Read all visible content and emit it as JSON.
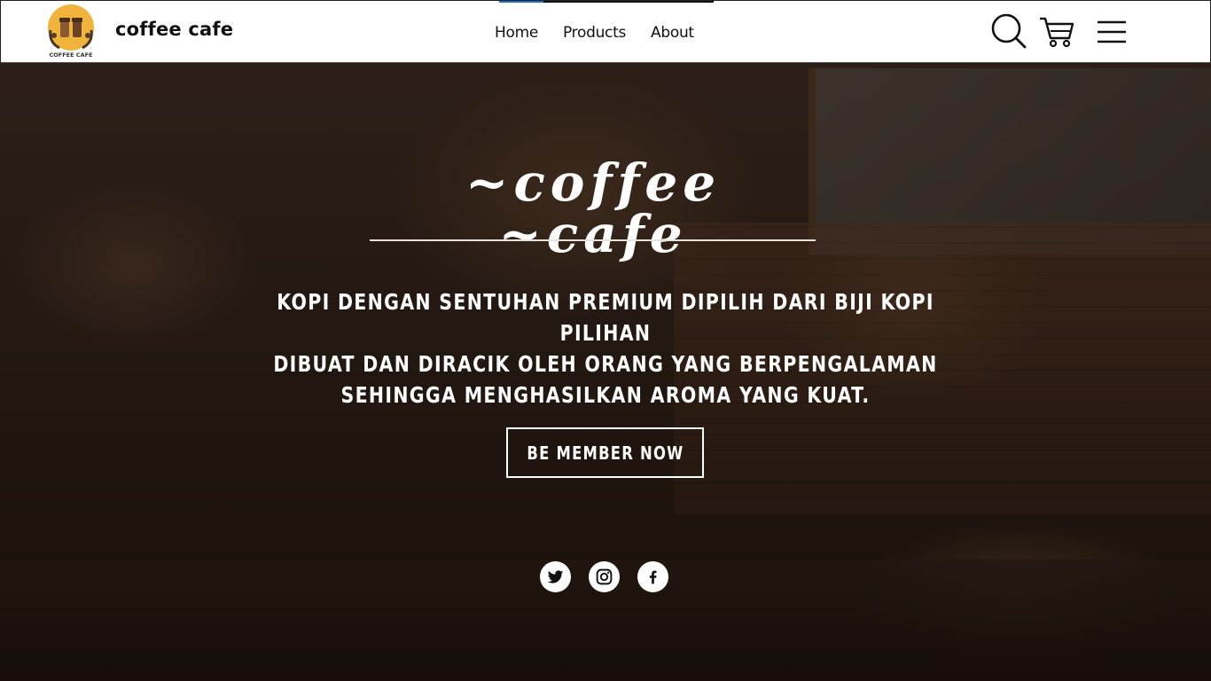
{
  "header": {
    "brand": "coffee cafe",
    "logo_text": "COFFEE CAFE",
    "nav": [
      "Home",
      "Products",
      "About"
    ],
    "icons": [
      "search-icon",
      "cart-icon",
      "menu-icon"
    ]
  },
  "hero": {
    "script_title": "~coffee ~cafe",
    "tagline_lines": [
      "KOPI DENGAN SENTUHAN PREMIUM DIPILIH DARI BIJI KOPI PILIHAN",
      "DIBUAT DAN DIRACIK OLEH ORANG YANG BERPENGALAMAN",
      "SEHINGGA MENGHASILKAN AROMA YANG KUAT."
    ],
    "cta_label": "BE MEMBER NOW",
    "socials": [
      "twitter-icon",
      "instagram-icon",
      "facebook-icon"
    ]
  },
  "colors": {
    "header_bg": "#ffffff",
    "text_dark": "#111111",
    "hero_text": "#ffffff",
    "nav_accent": "#1e6fc8",
    "logo_yellow": "#f0b43c"
  }
}
